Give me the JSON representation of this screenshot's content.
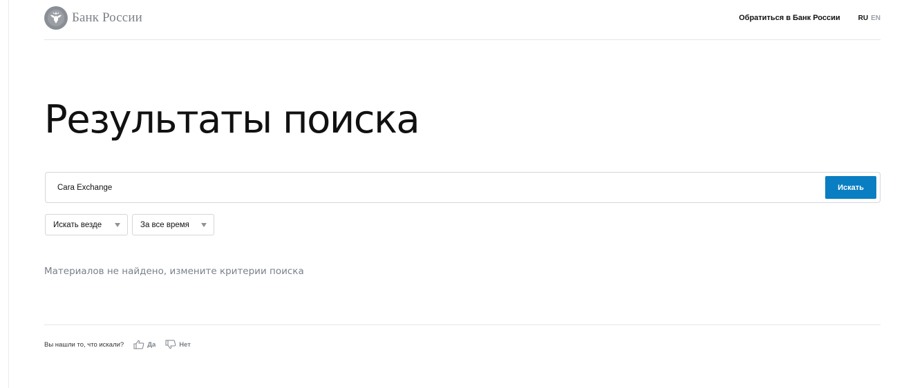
{
  "header": {
    "logo_text": "Банк России",
    "logo_icon": "double-headed-eagle-emblem",
    "contact_link": "Обратиться в Банк России",
    "lang_ru": "RU",
    "lang_en": "EN"
  },
  "main": {
    "title": "Результаты поиска",
    "search": {
      "value": "Cara Exchange",
      "button_label": "Искать"
    },
    "filters": [
      {
        "label": "Искать везде",
        "icon": "caret-down-icon"
      },
      {
        "label": "За все время",
        "icon": "caret-down-icon"
      }
    ],
    "empty_message": "Материалов не найдено, измените критерии поиска"
  },
  "feedback": {
    "question": "Вы нашли то, что искали?",
    "yes_label": "Да",
    "yes_icon": "thumbs-up-icon",
    "no_label": "Нет",
    "no_icon": "thumbs-down-icon"
  },
  "colors": {
    "accent": "#0a7ec2",
    "muted_text": "#7a8089",
    "border": "#d3d6da"
  }
}
